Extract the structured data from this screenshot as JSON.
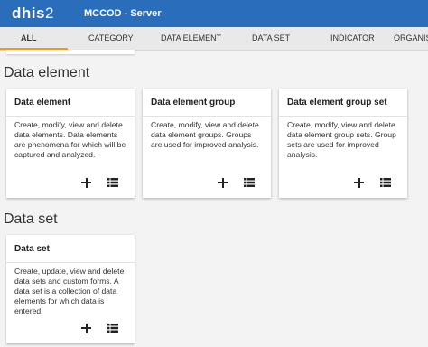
{
  "header": {
    "logo": "dhis",
    "logo_suffix": "2",
    "app_title": "MCCOD - Server"
  },
  "tabs": [
    "ALL",
    "CATEGORY",
    "DATA ELEMENT",
    "DATA SET",
    "INDICATOR",
    "ORGANIS"
  ],
  "sections": {
    "data_element": {
      "title": "Data element",
      "cards": [
        {
          "title": "Data element",
          "description": "Create, modify, view and delete data elements. Data elements are phenomena for which will be captured and analyzed."
        },
        {
          "title": "Data element group",
          "description": "Create, modify, view and delete data element groups. Groups are used for improved analysis."
        },
        {
          "title": "Data element group set",
          "description": "Create, modify, view and delete data element group sets. Group sets are used for improved analysis."
        }
      ]
    },
    "data_set": {
      "title": "Data set",
      "cards": [
        {
          "title": "Data set",
          "description": "Create, update, view and delete data sets and custom forms. A data set is a collection of data elements for which data is entered."
        }
      ]
    }
  },
  "icons": {
    "add": "plus-icon",
    "list": "list-icon"
  },
  "colors": {
    "header": "#2a6ebb",
    "tab_indicator": "#f39c12",
    "background": "#f3f3f3"
  }
}
